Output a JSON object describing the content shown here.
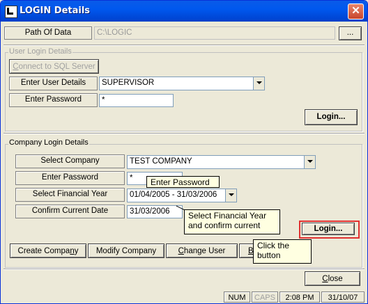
{
  "window": {
    "title": "LOGIN Details"
  },
  "path_of_data": {
    "label": "Path Of Data",
    "value": "C:\\LOGIC",
    "browse": "..."
  },
  "user_login": {
    "group_title": "User Login Details",
    "connect_button": "Connect to SQL Server",
    "user_label": "Enter User Details",
    "user_value": "SUPERVISOR",
    "password_label": "Enter Password",
    "password_value": "*",
    "login_button": "Login..."
  },
  "company_login": {
    "group_title": "Company Login Details",
    "company_label": "Select Company",
    "company_value": "TEST COMPANY",
    "password_label": "Enter Password",
    "password_value": "*",
    "fy_label": "Select Financial Year",
    "fy_value": "01/04/2005 - 31/03/2006",
    "date_label": "Confirm Current Date",
    "date_value": "31/03/2006",
    "login_button": "Login..."
  },
  "tooltips": {
    "enter_password": "Enter Password",
    "fy_line1": "Select Financial Year",
    "fy_line2": "and confirm current",
    "click_line1": "Click the",
    "click_line2": "button"
  },
  "actions": {
    "create_prefix": "Create Compa",
    "create_u": "n",
    "create_suffix": "y",
    "modify": "Modify Company",
    "change_prefix": "",
    "change_u": "C",
    "change_suffix": "hange User",
    "partial": "B",
    "close": "Close",
    "close_u": "C",
    "close_suffix": "lose"
  },
  "status_bar": {
    "num": "NUM",
    "caps": "CAPS",
    "time": "2:08 PM",
    "date": "31/10/07"
  },
  "colors": {
    "title_bar": "#0058ee",
    "highlight_border": "#e03030",
    "tooltip_bg": "#ffffe1"
  }
}
